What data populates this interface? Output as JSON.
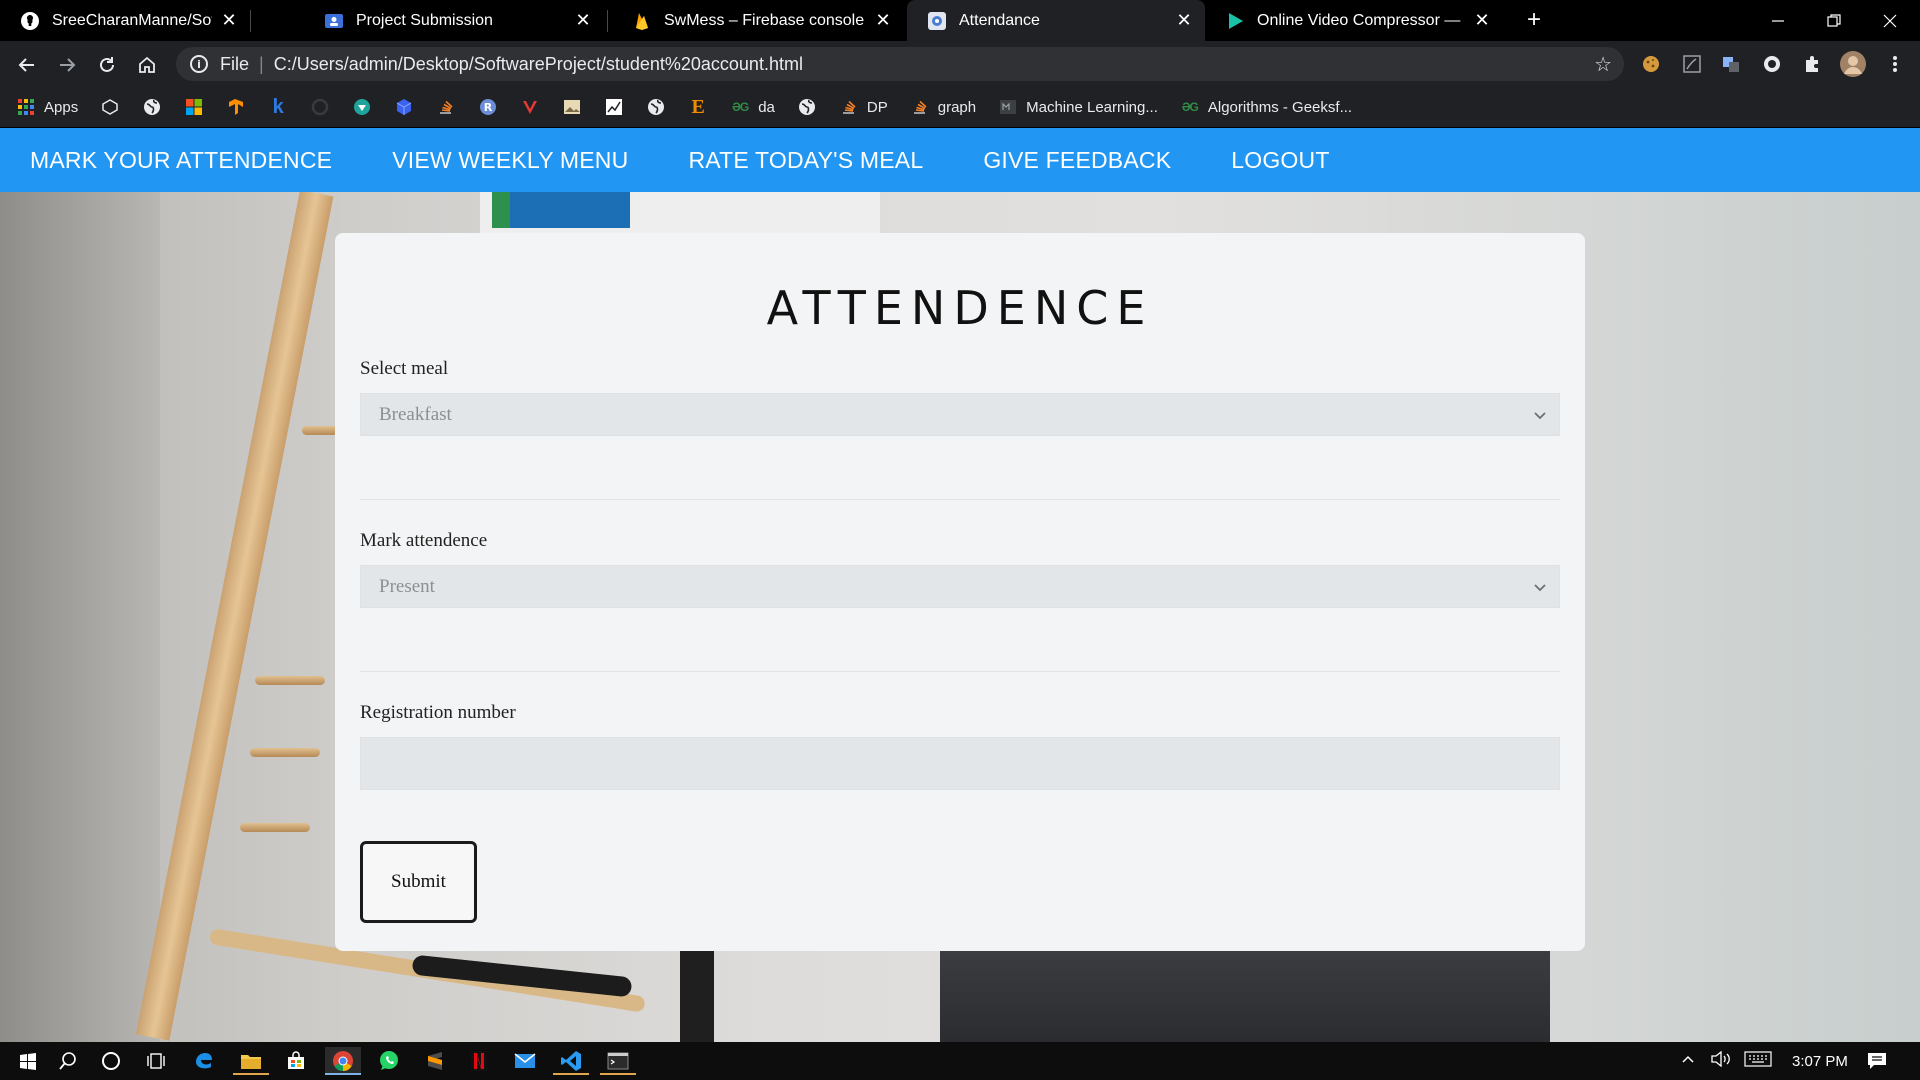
{
  "browser": {
    "tabs": [
      {
        "title": "SreeCharanManne/SoftwareProje",
        "icon": "github-icon",
        "active": false
      },
      {
        "title": "Project Submission",
        "icon": "classroom-icon",
        "active": false
      },
      {
        "title": "SwMess – Firebase console",
        "icon": "firebase-icon",
        "active": false
      },
      {
        "title": "Attendance",
        "icon": "page-icon",
        "active": true
      },
      {
        "title": "Online Video Compressor — Red",
        "icon": "play-icon",
        "active": false
      }
    ],
    "close_glyph": "✕",
    "new_tab_glyph": "+",
    "address": {
      "scheme_label": "File",
      "url": "C:/Users/admin/Desktop/SoftwareProject/student%20account.html",
      "info_glyph": "i"
    },
    "bookmarks": [
      {
        "icon": "apps-grid-icon",
        "label": "Apps",
        "color": "#e8eaed"
      },
      {
        "icon": "box-icon",
        "label": "",
        "color": "#e8eaed"
      },
      {
        "icon": "globe-icon",
        "label": "",
        "color": "#e8eaed"
      },
      {
        "icon": "microsoft-icon",
        "label": "",
        "color": "#f25022"
      },
      {
        "icon": "tensorflow-icon",
        "label": "",
        "color": "#ff8f00"
      },
      {
        "icon": "k-icon",
        "label": "",
        "color": "#2c7be5"
      },
      {
        "icon": "circle-dark-icon",
        "label": "",
        "color": "#444"
      },
      {
        "icon": "shield-icon",
        "label": "",
        "color": "#22a699"
      },
      {
        "icon": "cube-icon",
        "label": "",
        "color": "#3b63f0"
      },
      {
        "icon": "stackoverflow-icon",
        "label": "",
        "color": "#f48024"
      },
      {
        "icon": "r-icon",
        "label": "",
        "color": "#6c8ed9"
      },
      {
        "icon": "v-icon",
        "label": "",
        "color": "#e53935"
      },
      {
        "icon": "image-icon",
        "label": "",
        "color": "#e8eaed"
      },
      {
        "icon": "chart-icon",
        "label": "",
        "color": "#e8eaed"
      },
      {
        "icon": "globe-icon",
        "label": "",
        "color": "#e8eaed"
      },
      {
        "icon": "e-icon",
        "label": "",
        "color": "#f08c00"
      },
      {
        "icon": "geeks-icon",
        "label": "da",
        "color": "#2f8d46"
      },
      {
        "icon": "globe-icon",
        "label": "",
        "color": "#e8eaed"
      },
      {
        "icon": "stackoverflow-icon",
        "label": "DP",
        "color": "#f48024"
      },
      {
        "icon": "stackoverflow-icon",
        "label": "graph",
        "color": "#f48024"
      },
      {
        "icon": "ml-icon",
        "label": "Machine Learning...",
        "color": "#9aa0a6"
      },
      {
        "icon": "geeks-icon",
        "label": "Algorithms - Geeksf...",
        "color": "#2f8d46"
      }
    ]
  },
  "nav": {
    "links": [
      "MARK YOUR ATTENDENCE",
      "VIEW WEEKLY MENU",
      "RATE TODAY'S MEAL",
      "GIVE FEEDBACK",
      "LOGOUT"
    ]
  },
  "form": {
    "title": "ATTENDENCE",
    "meal_label": "Select meal",
    "meal_value": "Breakfast",
    "attendance_label": "Mark attendence",
    "attendance_value": "Present",
    "reg_label": "Registration number",
    "reg_value": "",
    "submit_label": "Submit"
  },
  "taskbar": {
    "clock": "3:07 PM",
    "apps": [
      "windows-start-icon",
      "search-icon",
      "cortana-icon",
      "task-view-icon",
      "edge-icon",
      "file-explorer-icon",
      "store-icon",
      "chrome-icon",
      "whatsapp-icon",
      "sublime-icon",
      "netflix-icon",
      "mail-icon",
      "vscode-icon",
      "terminal-icon"
    ]
  },
  "colors": {
    "nav_blue": "#2196f3",
    "card_bg": "#f2f4f5",
    "tab_active": "#202124"
  }
}
